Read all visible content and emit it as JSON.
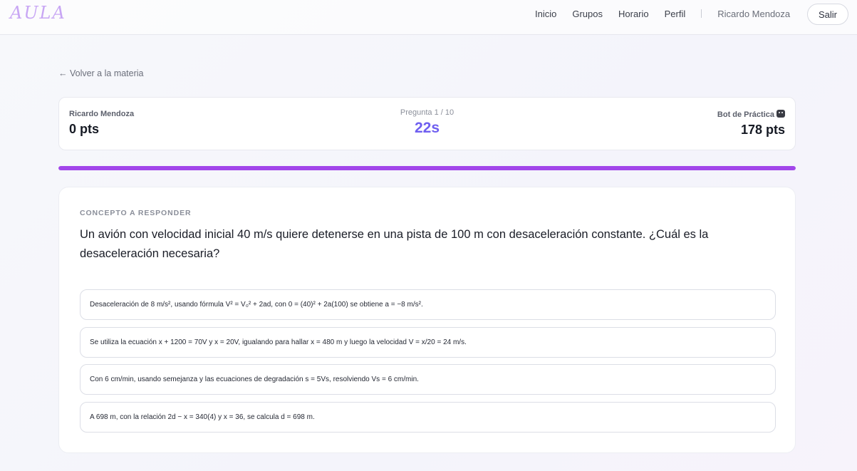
{
  "header": {
    "logo": "AULA",
    "nav": [
      "Inicio",
      "Grupos",
      "Horario",
      "Perfil"
    ],
    "user_name": "Ricardo Mendoza",
    "exit_label": "Salir"
  },
  "back_link": "← Volver a la materia",
  "scoreboard": {
    "player_name": "Ricardo Mendoza",
    "player_points": "0 pts",
    "question_counter": "Pregunta 1 / 10",
    "timer": "22s",
    "bot_name": "Bot de Práctica",
    "bot_icon": "robot-icon",
    "bot_points": "178 pts"
  },
  "progress": {
    "fraction": 1.0,
    "color": "#a246ea"
  },
  "question_card": {
    "kicker": "CONCEPTO A RESPONDER",
    "question": "Un avión con velocidad inicial 40 m/s quiere detenerse en una pista de 100 m con desaceleración constante. ¿Cuál es la desaceleración necesaria?",
    "options": [
      "Desaceleración de 8 m/s², usando fórmula V² = V₀² + 2ad, con 0 = (40)² + 2a(100) se obtiene a = −8 m/s².",
      "Se utiliza la ecuación x + 1200 = 70V y x = 20V, igualando para hallar x = 480 m y luego la velocidad V = x/20 = 24 m/s.",
      "Con 6 cm/min, usando semejanza y las ecuaciones de degradación s = 5Vs, resolviendo Vs = 6 cm/min.",
      "A 698 m, con la relación 2d − x = 340(4) y x = 36, se calcula d = 698 m."
    ]
  }
}
